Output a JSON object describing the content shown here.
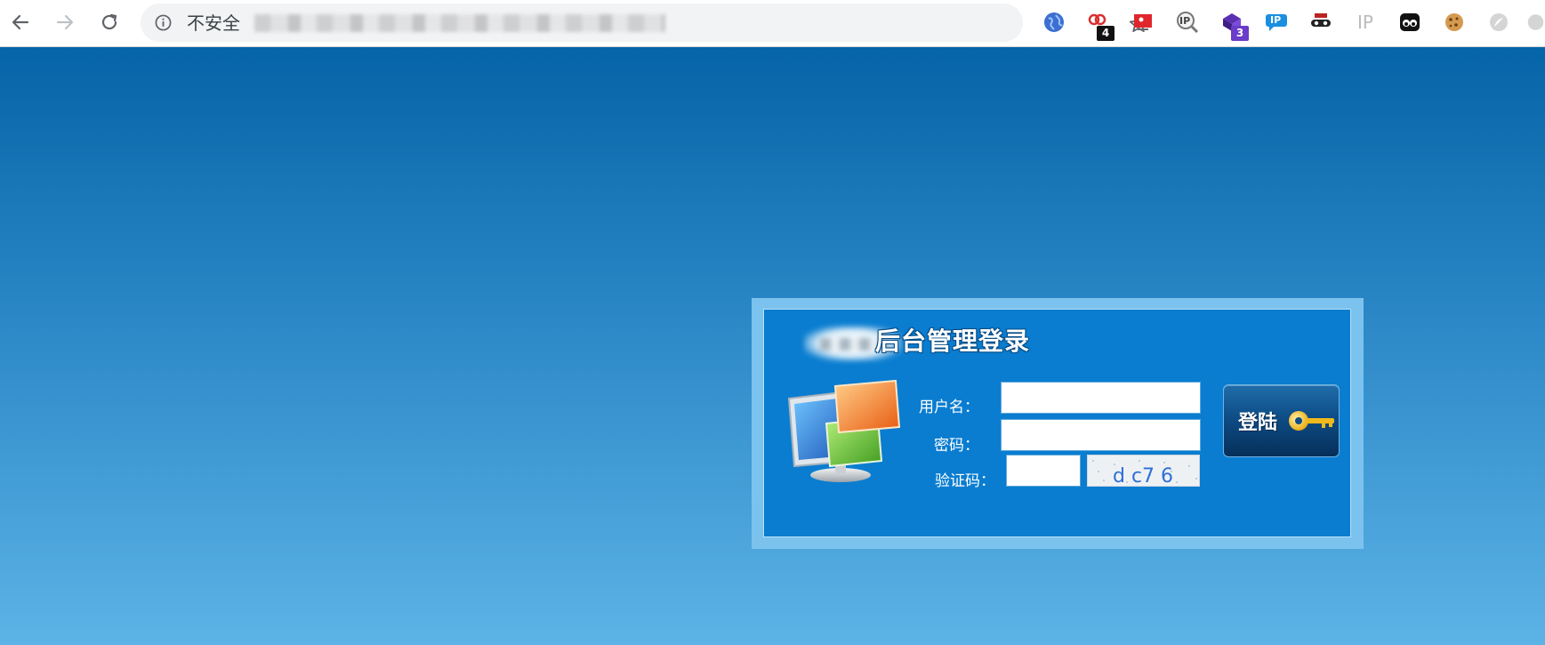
{
  "browser": {
    "address_bar": {
      "security_label": "不安全"
    },
    "extensions": [
      {
        "icon": "globe-icon"
      },
      {
        "icon": "key-chain-icon",
        "badge": "4",
        "badge_color": "#111111"
      },
      {
        "icon": "red-card-icon"
      },
      {
        "icon": "ip-search-icon",
        "text": "IP"
      },
      {
        "icon": "purple-cube-icon",
        "badge": "3",
        "badge_color": "#6a3cc8"
      },
      {
        "icon": "blue-ip-icon",
        "text": "IP"
      },
      {
        "icon": "spy-mask-icon"
      },
      {
        "icon": "ip-gray-icon",
        "text": "IP"
      },
      {
        "icon": "owl-eyes-icon"
      },
      {
        "icon": "cookie-icon"
      },
      {
        "icon": "gray-circle-icon"
      },
      {
        "icon": "gray-circle-icon"
      }
    ]
  },
  "login": {
    "title": "后台管理登录",
    "username_label": "用户名：",
    "username_value": "",
    "password_label": "密码：",
    "password_value": "",
    "captcha_label": "验证码：",
    "captcha_value": "",
    "captcha_text": "d c7 6",
    "submit_label": "登陆"
  },
  "colors": {
    "page_gradient_top": "#0564a7",
    "page_gradient_bottom": "#5cb3e6",
    "panel_outer": "#7cc2ee",
    "panel_inner": "#0a7dd0",
    "button_dark": "#062f5a"
  }
}
